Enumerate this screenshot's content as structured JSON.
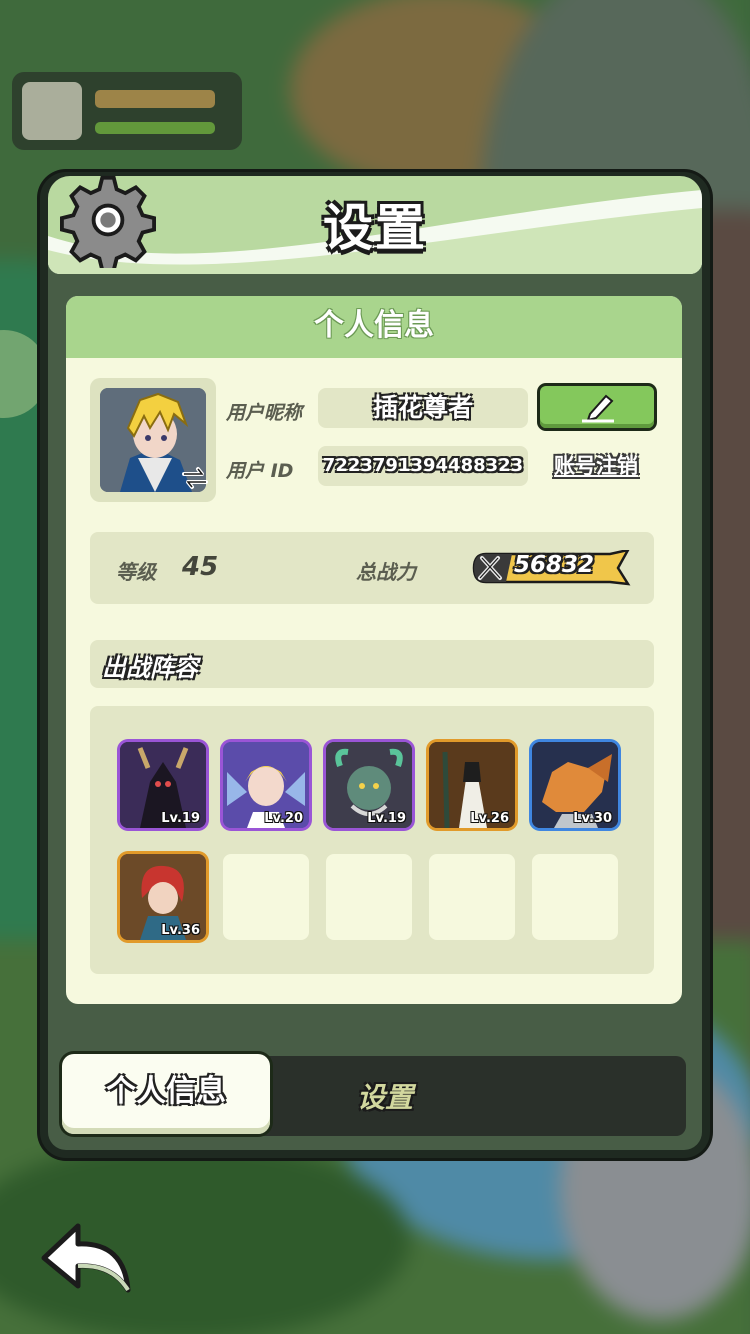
{
  "dialog": {
    "title": "设置",
    "section_header": "个人信息"
  },
  "profile": {
    "nickname_label": "用户昵称",
    "nickname": "插花尊者",
    "id_label": "用户 ID",
    "user_id": "7223791394488323",
    "delete_account": "账号注销",
    "level_label": "等级",
    "level": "45",
    "power_label": "总战力",
    "power": "56832"
  },
  "lineup": {
    "title": "出战阵容",
    "heroes": [
      {
        "level": "Lv.19",
        "rarity": "purple"
      },
      {
        "level": "Lv.20",
        "rarity": "purple"
      },
      {
        "level": "Lv.19",
        "rarity": "purple"
      },
      {
        "level": "Lv.26",
        "rarity": "orange"
      },
      {
        "level": "Lv.30",
        "rarity": "blue"
      },
      {
        "level": "Lv.36",
        "rarity": "orange"
      }
    ],
    "empty_slots": 4
  },
  "tabs": [
    {
      "label": "个人信息",
      "active": true
    },
    {
      "label": "设置",
      "active": false
    }
  ],
  "colors": {
    "accent_green": "#84c85c",
    "header_green": "#a9d58d",
    "panel_bg": "#f6f9de",
    "power_gold": "#f0c64a"
  },
  "icons": [
    "gear-icon",
    "swap-icon",
    "edit-icon",
    "sword-icon",
    "back-arrow-icon"
  ]
}
